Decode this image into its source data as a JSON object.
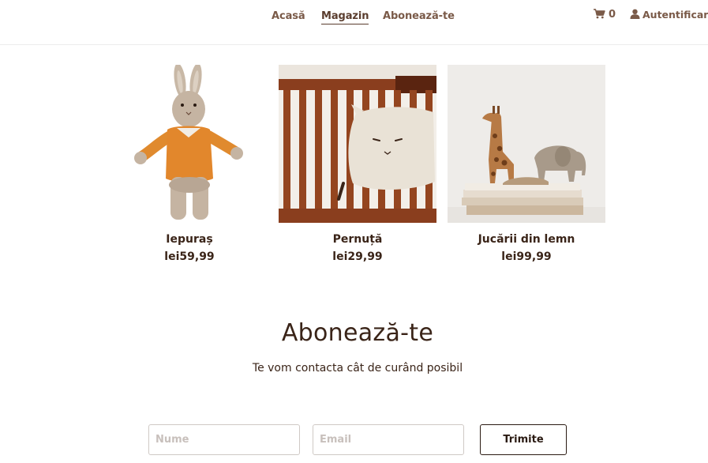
{
  "nav": {
    "items": [
      {
        "label": "Acasă"
      },
      {
        "label": "Magazin"
      },
      {
        "label": "Abonează-te"
      }
    ],
    "cart_count": "0",
    "login_label": "Autentificare"
  },
  "products": [
    {
      "name": "Iepuraș",
      "price": "lei59,99"
    },
    {
      "name": "Pernuță",
      "price": "lei29,99"
    },
    {
      "name": "Jucării din lemn",
      "price": "lei99,99"
    }
  ],
  "subscribe": {
    "title": "Abonează-te",
    "text": "Te vom contacta cât de curând posibil",
    "name_placeholder": "Nume",
    "email_placeholder": "Email",
    "submit_label": "Trimite"
  }
}
